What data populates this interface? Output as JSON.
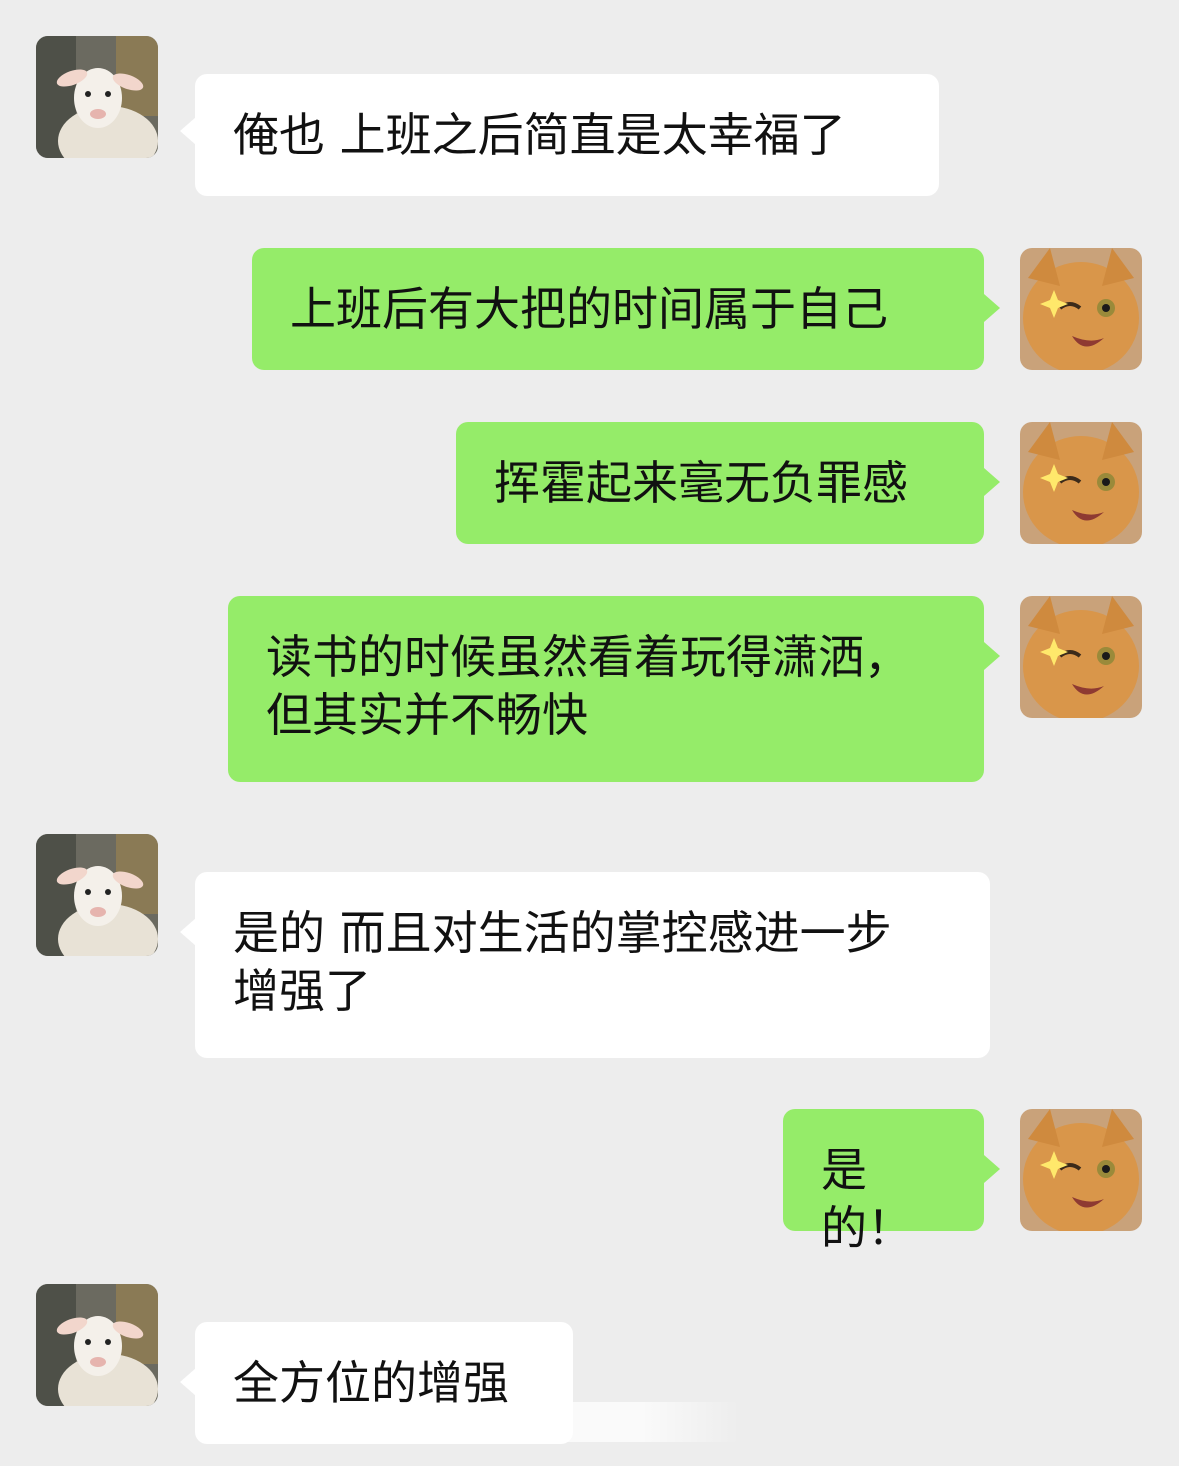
{
  "messages": [
    {
      "side": "left",
      "avatar": "lamb-avatar",
      "text": "俺也 上班之后简直是太幸福了"
    },
    {
      "side": "right",
      "avatar": "cat-avatar",
      "text": "上班后有大把的时间属于自己"
    },
    {
      "side": "right",
      "avatar": "cat-avatar",
      "text": "挥霍起来毫无负罪感"
    },
    {
      "side": "right",
      "avatar": "cat-avatar",
      "text_lines": [
        "读书的时候虽然看着玩得潇洒，",
        "但其实并不畅快"
      ]
    },
    {
      "side": "left",
      "avatar": "lamb-avatar",
      "text_lines": [
        "是的 而且对生活的掌控感进一步",
        "增强了"
      ]
    },
    {
      "side": "right",
      "avatar": "cat-avatar",
      "text": "是的！"
    },
    {
      "side": "left",
      "avatar": "lamb-avatar",
      "text": "全方位的增强"
    }
  ],
  "colors": {
    "background": "#ededed",
    "incoming_bubble": "#ffffff",
    "outgoing_bubble": "#95ec69",
    "text": "#111111"
  },
  "icons": {
    "left_avatar": "lamb-photo-icon",
    "right_avatar": "orange-cat-sparkle-icon"
  }
}
